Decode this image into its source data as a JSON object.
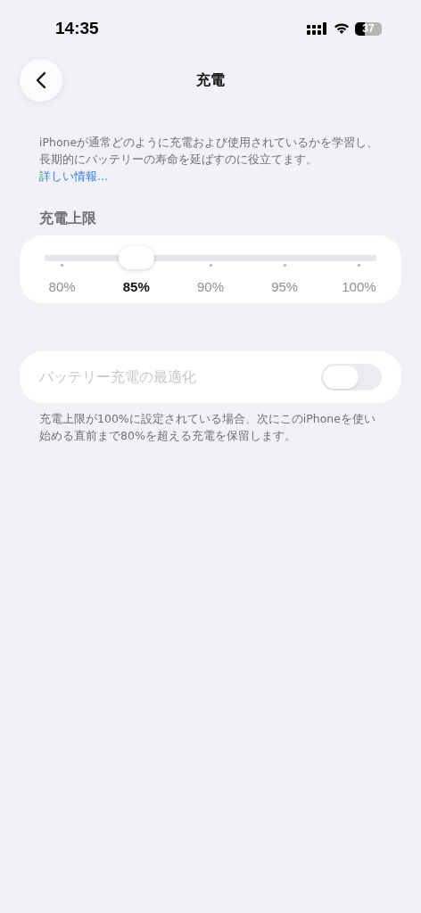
{
  "status_bar": {
    "time": "14:35",
    "battery": "37"
  },
  "nav": {
    "title": "充電"
  },
  "intro": {
    "text": "iPhoneが通常どのように充電および使用されているかを学習し、長期的にバッテリーの寿命を延ばすのに役立てます。",
    "link": "詳しい情報..."
  },
  "charge_limit": {
    "header": "充電上限",
    "level": 0.25,
    "stops": [
      {
        "label": "80%",
        "selected": false
      },
      {
        "label": "85%",
        "selected": true
      },
      {
        "label": "90%",
        "selected": false
      },
      {
        "label": "95%",
        "selected": false
      },
      {
        "label": "100%",
        "selected": false
      }
    ]
  },
  "optimize": {
    "label": "バッテリー充電の最適化",
    "on": false,
    "disabled": true,
    "footer": "充電上限が100%に設定されている場合、次にこのiPhoneを使い始める直前まで80%を超える充電を保留します。"
  }
}
